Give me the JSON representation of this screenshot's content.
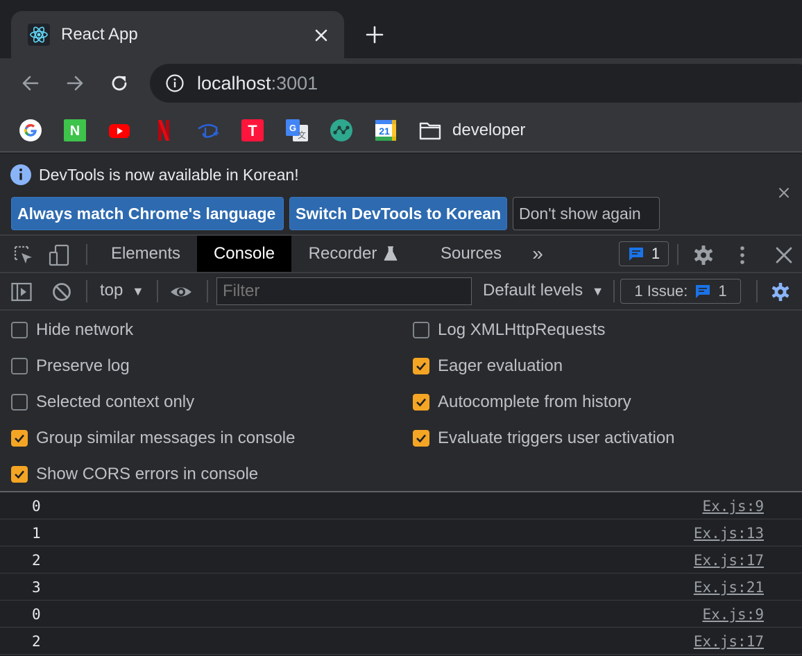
{
  "browser": {
    "tab": {
      "title": "React App",
      "favicon": "react-icon"
    },
    "address": {
      "host": "localhost",
      "port": ":3001"
    },
    "bookmarks": [
      {
        "name": "google",
        "icon": "google-icon"
      },
      {
        "name": "naver",
        "icon": "naver-icon",
        "letter": "N"
      },
      {
        "name": "youtube",
        "icon": "youtube-icon"
      },
      {
        "name": "netflix",
        "icon": "netflix-icon",
        "letter": "N"
      },
      {
        "name": "disney-plus",
        "icon": "disney-plus-icon"
      },
      {
        "name": "tving",
        "icon": "tving-icon",
        "letter": "T"
      },
      {
        "name": "google-translate",
        "icon": "translate-icon"
      },
      {
        "name": "sourcetree",
        "icon": "git-graph-icon"
      },
      {
        "name": "google-calendar",
        "icon": "calendar-icon",
        "letter": "21"
      }
    ],
    "bookmark_folder": {
      "label": "developer",
      "icon": "folder-icon"
    }
  },
  "infobar": {
    "message": "DevTools is now available in Korean!",
    "buttons": {
      "match_language": "Always match Chrome's language",
      "switch_korean": "Switch DevTools to Korean",
      "dont_show": "Don't show again"
    }
  },
  "devtools": {
    "tabs": {
      "elements": "Elements",
      "console": "Console",
      "recorder": "Recorder",
      "sources": "Sources"
    },
    "more_tabs": "»",
    "issues_count": "1",
    "active_tab": "Console"
  },
  "console_toolbar": {
    "context": "top",
    "filter_placeholder": "Filter",
    "levels": "Default levels",
    "issues_label": "1 Issue:",
    "issues_count": "1"
  },
  "settings": {
    "left": [
      {
        "label": "Hide network",
        "checked": false
      },
      {
        "label": "Preserve log",
        "checked": false
      },
      {
        "label": "Selected context only",
        "checked": false
      },
      {
        "label": "Group similar messages in console",
        "checked": true
      },
      {
        "label": "Show CORS errors in console",
        "checked": true
      }
    ],
    "right": [
      {
        "label": "Log XMLHttpRequests",
        "checked": false
      },
      {
        "label": "Eager evaluation",
        "checked": true
      },
      {
        "label": "Autocomplete from history",
        "checked": true
      },
      {
        "label": "Evaluate triggers user activation",
        "checked": true
      }
    ]
  },
  "console_log": [
    {
      "value": "0",
      "source": "Ex.js:9"
    },
    {
      "value": "1",
      "source": "Ex.js:13"
    },
    {
      "value": "2",
      "source": "Ex.js:17"
    },
    {
      "value": "3",
      "source": "Ex.js:21"
    },
    {
      "value": "0",
      "source": "Ex.js:9"
    },
    {
      "value": "2",
      "source": "Ex.js:17"
    }
  ],
  "colors": {
    "checkbox_checked": "#f5a524",
    "primary_button": "#2d6ab0",
    "info_icon": "#8ab4f8",
    "issue_icon": "#1a73e8"
  }
}
